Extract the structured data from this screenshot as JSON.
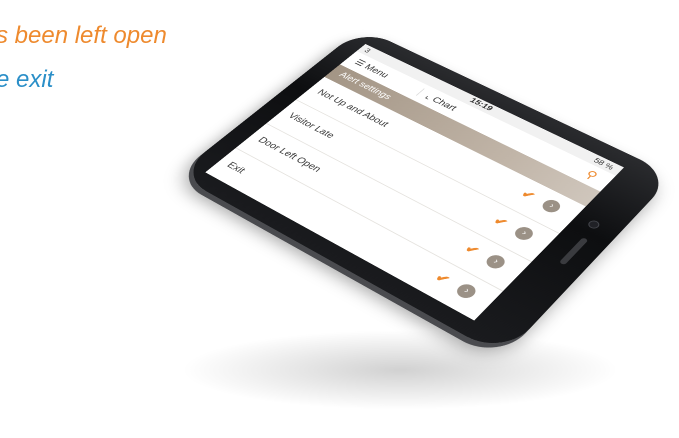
{
  "headlines": {
    "line1": "s been left open",
    "line2": "e exit"
  },
  "status_bar": {
    "carrier": "3",
    "time": "15:19",
    "battery": "58 %"
  },
  "top_bar": {
    "menu_label": "Menu",
    "chart_label": "Chart",
    "share_icon": "share-icon"
  },
  "alert_settings": {
    "title": "Alert settings"
  },
  "alerts": [
    {
      "label": "Not Up and About",
      "checked": true
    },
    {
      "label": "Visitor Late",
      "checked": true
    },
    {
      "label": "Door Left Open",
      "checked": true
    },
    {
      "label": "Exit",
      "checked": true
    }
  ],
  "colors": {
    "accent_orange": "#ee8a2e",
    "accent_blue": "#2b8fc8",
    "header_taupe": "#a39585"
  }
}
